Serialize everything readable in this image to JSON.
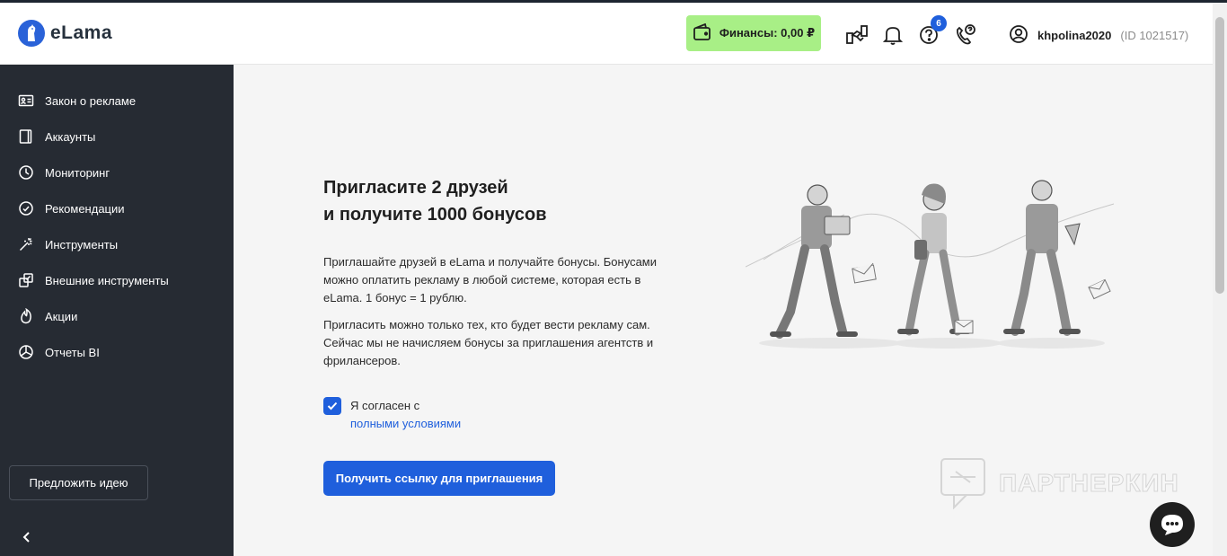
{
  "brand": {
    "logo_text": "eLama",
    "accent": "#1f5fdc",
    "finance_bg": "#a8ef86"
  },
  "header": {
    "finance_label": "Финансы: 0,00 ₽",
    "help_badge": "6",
    "username": "khpolina2020",
    "user_id": "(ID 1021517)",
    "icons": [
      "wallet-icon",
      "handshake-icon",
      "bell-icon",
      "help-icon",
      "phone-icon",
      "user-icon"
    ]
  },
  "sidebar": {
    "items": [
      {
        "label": "Закон о рекламе",
        "icon": "id-card-icon"
      },
      {
        "label": "Аккаунты",
        "icon": "book-icon"
      },
      {
        "label": "Мониторинг",
        "icon": "clock-icon"
      },
      {
        "label": "Рекомендации",
        "icon": "check-circle-icon"
      },
      {
        "label": "Инструменты",
        "icon": "magic-wand-icon"
      },
      {
        "label": "Внешние инструменты",
        "icon": "external-icon"
      },
      {
        "label": "Акции",
        "icon": "fire-icon"
      },
      {
        "label": "Отчеты BI",
        "icon": "chart-pie-icon"
      }
    ],
    "idea_button": "Предложить идею",
    "collapse_icon": "chevron-left-icon"
  },
  "main": {
    "title_line1": "Пригласите 2 друзей",
    "title_line2": "и получите 1000 бонусов",
    "para1": "Приглашайте друзей в eLama и получайте бонусы. Бонусами можно оплатить рекламу в любой системе, которая есть в eLama. 1 бонус = 1 рублю.",
    "para2": "Пригласить можно только тех, кто будет вести рекламу сам. Сейчас мы не начисляем бонусы за приглашения агентств и фрилансеров.",
    "agree_text": "Я согласен с",
    "terms_link": "полными условиями",
    "agree_checked": true,
    "cta_label": "Получить ссылку для приглашения"
  },
  "watermark": {
    "text": "ПАРТНЕРКИН"
  }
}
